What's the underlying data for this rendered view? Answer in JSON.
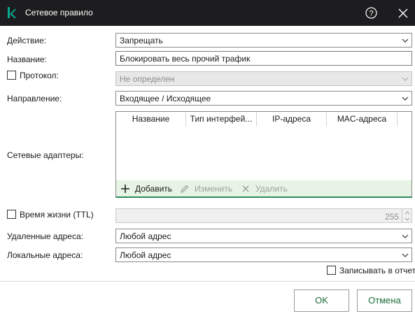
{
  "window": {
    "title": "Сетевое правило"
  },
  "labels": {
    "action": "Действие:",
    "name": "Название:",
    "protocol": "Протокол:",
    "direction": "Направление:",
    "adapters": "Сетевые адаптеры:",
    "ttl": "Время жизни (TTL)",
    "remote": "Удаленные адреса:",
    "local": "Локальные адреса:"
  },
  "fields": {
    "action": "Запрещать",
    "name": "Блокировать весь прочий трафик",
    "protocol": "Не определен",
    "direction": "Входящее / Исходящее",
    "ttl": "255",
    "remote": "Любой адрес",
    "local": "Любой адрес"
  },
  "adapters_table": {
    "columns": [
      "Название",
      "Тип интерфей...",
      "IP-адреса",
      "MAC-адреса"
    ]
  },
  "toolbar": {
    "add": "Добавить",
    "edit": "Изменить",
    "delete": "Удалить"
  },
  "log_label": "Записывать в отчет",
  "buttons": {
    "ok": "OK",
    "cancel": "Отмена"
  },
  "colors": {
    "titlebar": "#1d1d1f",
    "accent": "#00a88e",
    "toolbar_bg": "#e7f3e4",
    "button_text": "#1a6b3a"
  },
  "icons": [
    "kaspersky-logo-icon",
    "help-icon",
    "close-icon",
    "chevron-down-icon",
    "plus-icon",
    "pencil-icon",
    "x-icon"
  ]
}
